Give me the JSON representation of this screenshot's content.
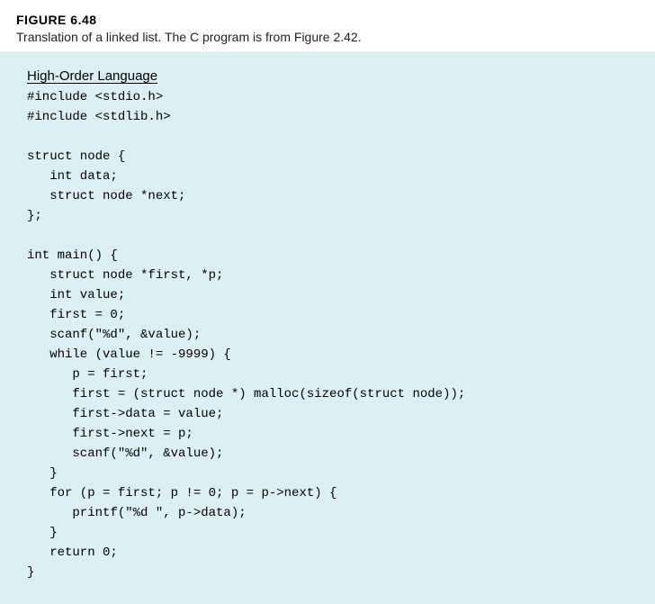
{
  "figure": {
    "label": "FIGURE 6.48",
    "caption": "Translation of a linked list. The C program is from Figure 2.42."
  },
  "section_title": "High-Order Language",
  "code_lines": [
    "#include <stdio.h>",
    "#include <stdlib.h>",
    "",
    "struct node {",
    "   int data;",
    "   struct node *next;",
    "};",
    "",
    "int main() {",
    "   struct node *first, *p;",
    "   int value;",
    "   first = 0;",
    "   scanf(\"%d\", &value);",
    "   while (value != -9999) {",
    "      p = first;",
    "      first = (struct node *) malloc(sizeof(struct node));",
    "      first->data = value;",
    "      first->next = p;",
    "      scanf(\"%d\", &value);",
    "   }",
    "   for (p = first; p != 0; p = p->next) {",
    "      printf(\"%d \", p->data);",
    "   }",
    "   return 0;",
    "}"
  ]
}
